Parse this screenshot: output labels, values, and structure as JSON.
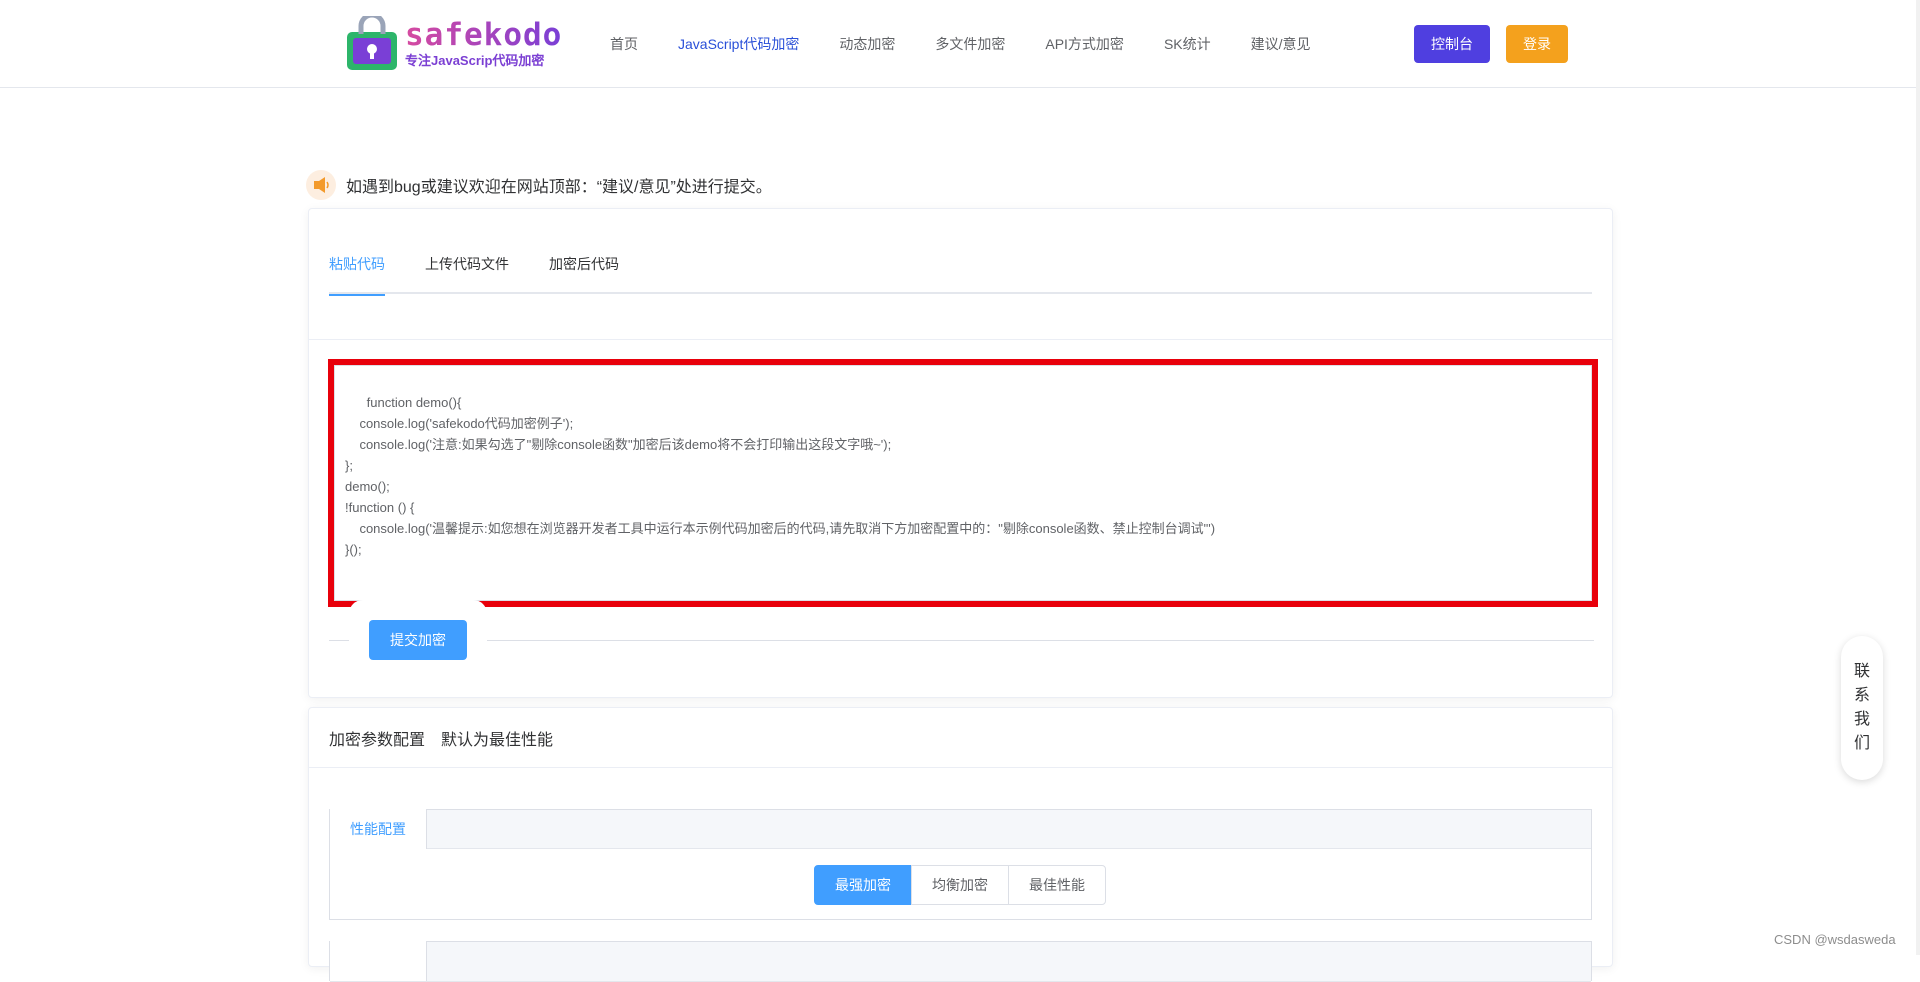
{
  "header": {
    "logo_title": "safekodo",
    "logo_subtitle": "专注JavaScrip代码加密",
    "nav": [
      {
        "label": "首页",
        "active": false
      },
      {
        "label": "JavaScript代码加密",
        "active": true
      },
      {
        "label": "动态加密",
        "active": false
      },
      {
        "label": "多文件加密",
        "active": false
      },
      {
        "label": "API方式加密",
        "active": false
      },
      {
        "label": "SK统计",
        "active": false
      },
      {
        "label": "建议/意见",
        "active": false
      }
    ],
    "console_label": "控制台",
    "login_label": "登录"
  },
  "notice": {
    "text": "如遇到bug或建议欢迎在网站顶部：“建议/意见”处进行提交。"
  },
  "editor": {
    "tabs": [
      "粘贴代码",
      "上传代码文件",
      "加密后代码"
    ],
    "active_tab": "粘贴代码",
    "code": "function demo(){\n    console.log('safekodo代码加密例子');\n    console.log('注意:如果勾选了\"剔除console函数\"加密后该demo将不会打印输出这段文字哦~');\n};\ndemo();\n!function () {\n    console.log('温馨提示:如您想在浏览器开发者工具中运行本示例代码加密后的代码,请先取消下方加密配置中的：\"剔除console函数、禁止控制台调试\"')\n}();",
    "submit_label": "提交加密"
  },
  "config": {
    "title": "加密参数配置",
    "subtitle": "默认为最佳性能",
    "perf_tab": "性能配置",
    "options": [
      "最强加密",
      "均衡加密",
      "最佳性能"
    ],
    "selected": "最强加密"
  },
  "contact": {
    "chars": [
      "联",
      "系",
      "我",
      "们"
    ]
  },
  "watermark": "CSDN @wsdasweda",
  "colors": {
    "primary": "#409eff",
    "console_btn": "#4f3fe0",
    "login_btn": "#f4a11d",
    "highlight_border": "#e8000b",
    "active_nav": "#2a50d8"
  }
}
